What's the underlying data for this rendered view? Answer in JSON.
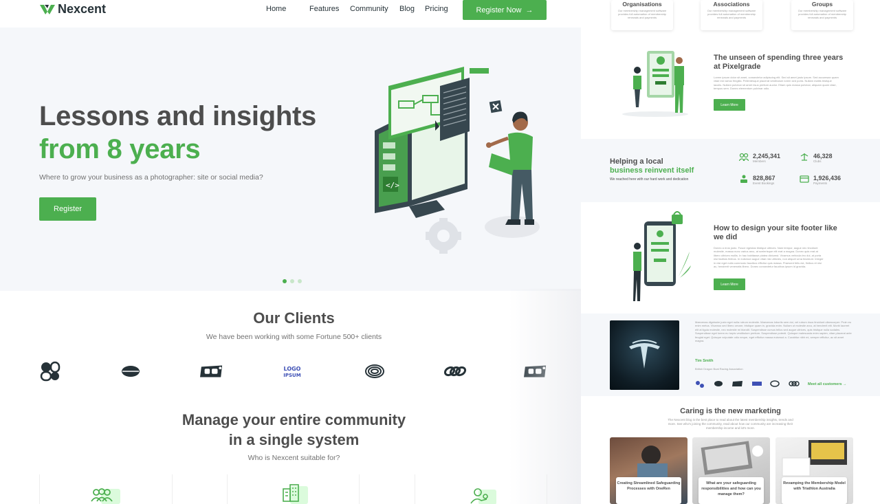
{
  "nav": {
    "logo_text": "Nexcent",
    "links": [
      "Home",
      "Features",
      "Community",
      "Blog",
      "Pricing"
    ],
    "cta_label": "Register Now",
    "cta_arrow": "→"
  },
  "hero": {
    "title_line1": "Lessons and insights",
    "title_line2": "from 8 years",
    "subtitle": "Where to grow your business as a photographer: site or social media?",
    "button_label": "Register",
    "carousel_dots": 3,
    "active_dot": 0
  },
  "clients": {
    "title": "Our Clients",
    "subtitle": "We have been working with some Fortune 500+ clients",
    "logo_text": "LOGO IPSUM"
  },
  "community": {
    "title_line1": "Manage your entire community",
    "title_line2": "in a single system",
    "subtitle": "Who is Nexcent suitable for?"
  },
  "right": {
    "cards": [
      {
        "title": "Organisations",
        "text": "Our membership management software provides full automation of membership renewals and payments"
      },
      {
        "title": "Associations",
        "text": "Our membership management software provides full automation of membership renewals and payments"
      },
      {
        "title": "Groups",
        "text": "Our membership management software provides full automation of membership renewals and payments"
      }
    ],
    "feature1": {
      "title": "The unseen of spending three years at Pixelgrade",
      "text": "Lorem ipsum dolor sit amet, consectetur adipiscing elit. Sed sit amet justo ipsum. Sed accumsan quam vitae est varius fringilla. Pellentesque placerat vestibulum lorem sed porta. Nullam mattis tristique iaculis. Nullam pulvinar sit amet risus pretium auctor. Etiam quis massa pulvinar, aliquam quam vitae, tempus sem. Donec elementum pulvinar odio.",
      "button_label": "Learn More"
    },
    "stats": {
      "title_line1": "Helping a local",
      "title_line2": "business reinvent itself",
      "subtitle": "We reached here with our hard work and dedication",
      "items": [
        {
          "value": "2,245,341",
          "label": "Members"
        },
        {
          "value": "46,328",
          "label": "Clubs"
        },
        {
          "value": "828,867",
          "label": "Event Bookings"
        },
        {
          "value": "1,926,436",
          "label": "Payments"
        }
      ]
    },
    "feature2": {
      "title": "How to design your site footer like we did",
      "text": "Donec a eros justo. Fusce egestas tristique ultrices. Nam tempor, augue nec tincidunt molestie, massa nunc varius arcu, at scelerisque elit erat a magna. Donec quis erat at libero ultrices mollis. In hac habitasse platea dictumst. Vivamus vehicula leo dui, at porta nisi facilisis finibus. In euismod augue vitae nisi ultricies, non aliquet urna tincidunt. Integer in nisi eget nulla commodo faucibus efficitur quis massa. Praesent felis est, finibus et nisi ac, hendrerit venenatis libero. Donec consectetur faucibus ipsum id gravida.",
      "button_label": "Learn More"
    },
    "testimonial": {
      "text": "Maecenas dignissim justo eget nulla rutrum molestie. Maecenas lobortis sem dui, vel rutrum risus tincidunt ullamcorper. Proin eu enim metus. Vivamus sed libero ornare, tristique quam in, gravida enim. Nullam ut molestie arcu, at hendrerit elit. Morbi laoreet elit at ligula molestie, nec molestie mi blandit. Suspendisse cursus tellus sed augue ultrices, quis tristique nulla sodales. Suspendisse eget lorem eu turpis vestibulum pretium. Suspendisse potenti. Quisque malesuada enim sapien, vitae placerat ante feugiat eget. Quisque vulputate odio neque, eget efficitur massa euismod a. Curabitur nibh mi, semper efficitur, ac sit amet magna.",
      "name": "Tim Smith",
      "role": "British Dragon Boat Racing Association",
      "link_label": "Meet all customers →"
    },
    "blog": {
      "title": "Caring is the new marketing",
      "subtitle": "The Nexcent blog is the best place to read about the latest membership insights, trends and more. See who's joining the community, read about how our community are increasing their membership income and lot's more.",
      "posts": [
        {
          "caption": "Creating Streamlined Safeguarding Processes with OneRen"
        },
        {
          "caption": "What are your safeguarding responsibilities and how can you manage them?"
        },
        {
          "caption": "Revamping the Membership Model with Triathlon Australia"
        }
      ]
    }
  },
  "colors": {
    "primary": "#4CAF4F",
    "dark_text": "#4D4D4D",
    "muted_text": "#717171",
    "silver": "#F5F7FA",
    "header_dark": "#263238"
  }
}
